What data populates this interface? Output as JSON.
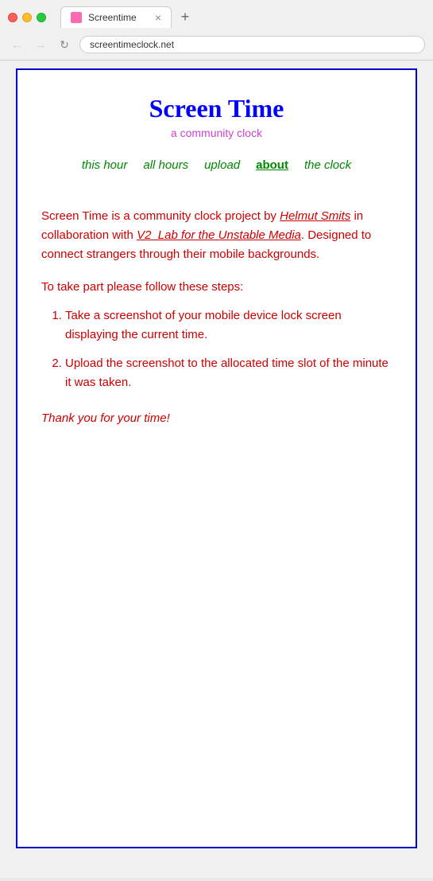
{
  "browser": {
    "tab_title": "Screentime",
    "url": "screentimeclock.net",
    "new_tab_symbol": "+"
  },
  "nav": {
    "back_symbol": "←",
    "forward_symbol": "→",
    "refresh_symbol": "↻"
  },
  "site": {
    "title": "Screen Time",
    "subtitle": "a community clock"
  },
  "navigation": {
    "items": [
      {
        "label": "this hour",
        "active": false
      },
      {
        "label": "all hours",
        "active": false
      },
      {
        "label": "upload",
        "active": false
      },
      {
        "label": "about",
        "active": true
      },
      {
        "label": "the clock",
        "active": false
      }
    ]
  },
  "content": {
    "paragraph1_intro": "Screen Time is a community clock project by ",
    "author1": "Helmut Smits",
    "paragraph1_mid": " in collaboration with ",
    "author2": "V2_Lab for the Unstable Media",
    "paragraph1_end": ". Designed to connect strangers through their mobile backgrounds.",
    "steps_intro": "To take part please follow these steps:",
    "step1": "Take a screenshot of your mobile device lock screen displaying the current time.",
    "step2": "Upload the screenshot to the allocated time slot of the minute it was taken.",
    "thank_you": "Thank you for your time!"
  }
}
